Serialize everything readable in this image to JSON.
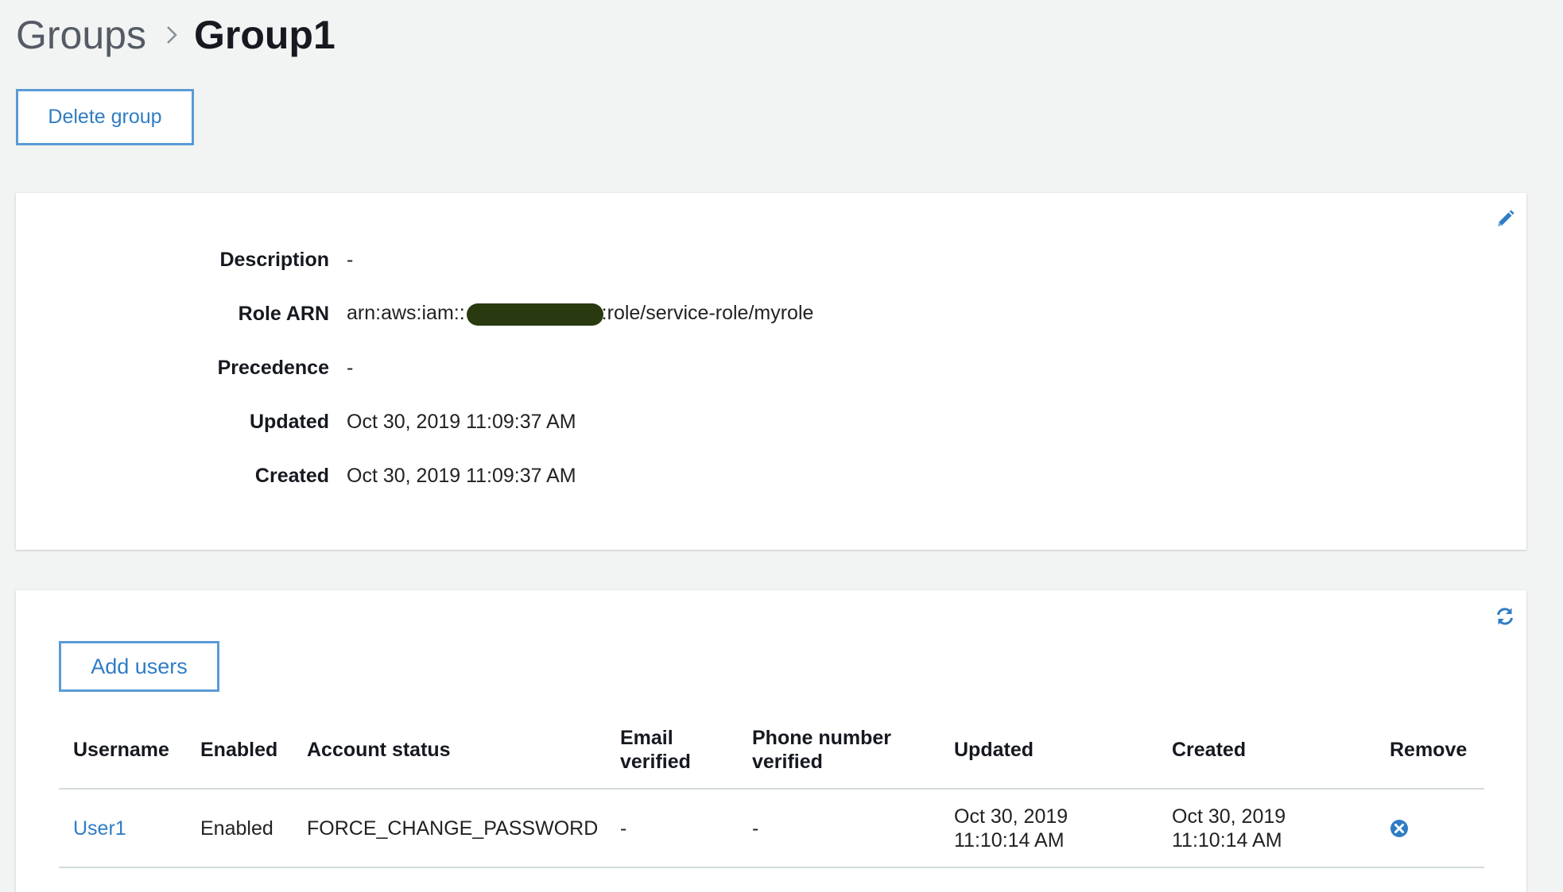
{
  "breadcrumb": {
    "parent": "Groups",
    "separator_icon": "chevron-right-icon",
    "current": "Group1"
  },
  "actions": {
    "delete_group_label": "Delete group"
  },
  "details": {
    "edit_icon": "pencil-icon",
    "rows": [
      {
        "label": "Description",
        "value": "-"
      },
      {
        "label": "Role ARN",
        "value_prefix": "arn:aws:iam::",
        "value_suffix": ":role/service-role/myrole"
      },
      {
        "label": "Precedence",
        "value": "-"
      },
      {
        "label": "Updated",
        "value": "Oct 30, 2019 11:09:37 AM"
      },
      {
        "label": "Created",
        "value": "Oct 30, 2019 11:09:37 AM"
      }
    ]
  },
  "users": {
    "refresh_icon": "refresh-icon",
    "add_users_label": "Add users",
    "columns": [
      "Username",
      "Enabled",
      "Account status",
      "Email verified",
      "Phone number verified",
      "Updated",
      "Created",
      "Remove"
    ],
    "rows": [
      {
        "username": "User1",
        "enabled": "Enabled",
        "account_status": "FORCE_CHANGE_PASSWORD",
        "email_verified": "-",
        "phone_verified": "-",
        "updated_date": "Oct 30, 2019",
        "updated_time": "11:10:14 AM",
        "created_date": "Oct 30, 2019",
        "created_time": "11:10:14 AM",
        "remove_icon": "remove-circle-icon"
      }
    ]
  },
  "colors": {
    "accent": "#2f7dc4",
    "button_border": "#5a9bd5",
    "background": "#f2f3f3",
    "redaction": "#2a3a10"
  }
}
